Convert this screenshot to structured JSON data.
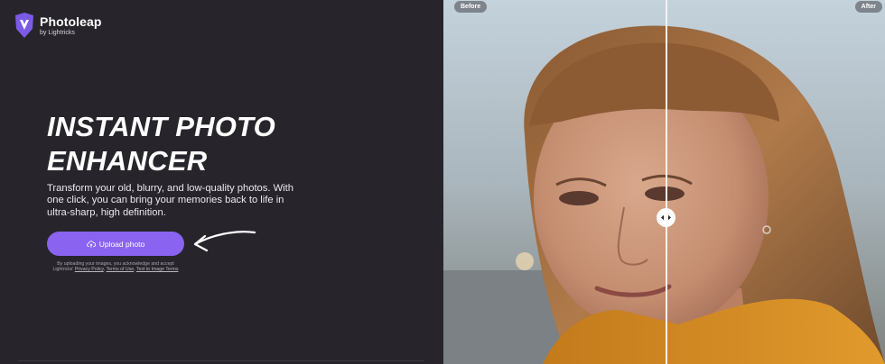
{
  "brand": {
    "name": "Photoleap",
    "tagline": "by Lightricks",
    "color": "#7b5ae6"
  },
  "hero": {
    "title_line1": "INSTANT PHOTO",
    "title_line2": "ENHANCER",
    "description": "Transform your old, blurry, and low-quality photos. With one click, you can bring your memories back to life in ultra-sharp, high definition."
  },
  "upload": {
    "label": "Upload photo",
    "icon": "upload-cloud-icon",
    "color": "#8a63f0"
  },
  "disclaimer": {
    "text": "By uploading your images, you acknowledge and accept Lightricks'",
    "privacy_link": "Privacy Policy",
    "terms_link": "Terms of Use",
    "tti_link": "Text to Image Terms"
  },
  "comparison": {
    "before_label": "Before",
    "after_label": "After",
    "handle_icon": "left-right-arrows-icon",
    "split_position": 0.5
  }
}
